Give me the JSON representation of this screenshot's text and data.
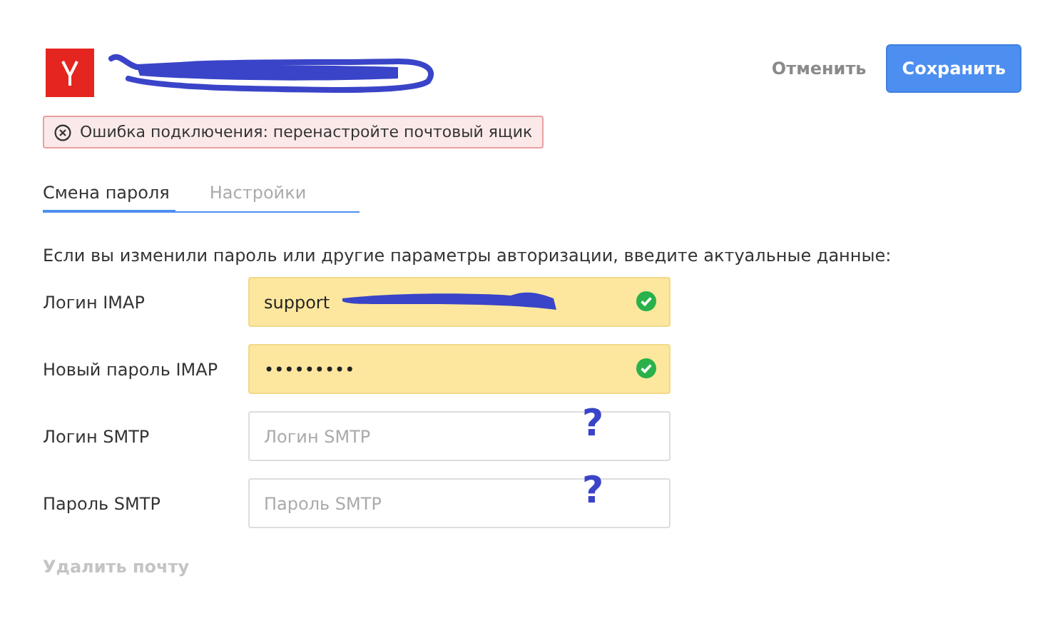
{
  "header": {
    "cancel": "Отменить",
    "save": "Сохранить"
  },
  "error": {
    "message": "Ошибка подключения: перенастройте почтовый ящик"
  },
  "tabs": [
    {
      "label": "Смена пароля",
      "selected": true
    },
    {
      "label": "Настройки",
      "selected": false
    }
  ],
  "intro": "Если вы изменили пароль или другие параметры авторизации, введите актуальные данные:",
  "fields": [
    {
      "label": "Логин IMAP",
      "value": "support",
      "valid": true,
      "redacted": true
    },
    {
      "label": "Новый пароль IMAP",
      "value": "•••••••••",
      "valid": true,
      "redacted": false
    },
    {
      "label": "Логин SMTP",
      "placeholder": "Логин SMTP",
      "valid": false,
      "redacted": false,
      "annotation": "?"
    },
    {
      "label": "Пароль SMTP",
      "placeholder": "Пароль SMTP",
      "valid": false,
      "redacted": false,
      "annotation": "?"
    }
  ],
  "delete_link": "Удалить почту"
}
